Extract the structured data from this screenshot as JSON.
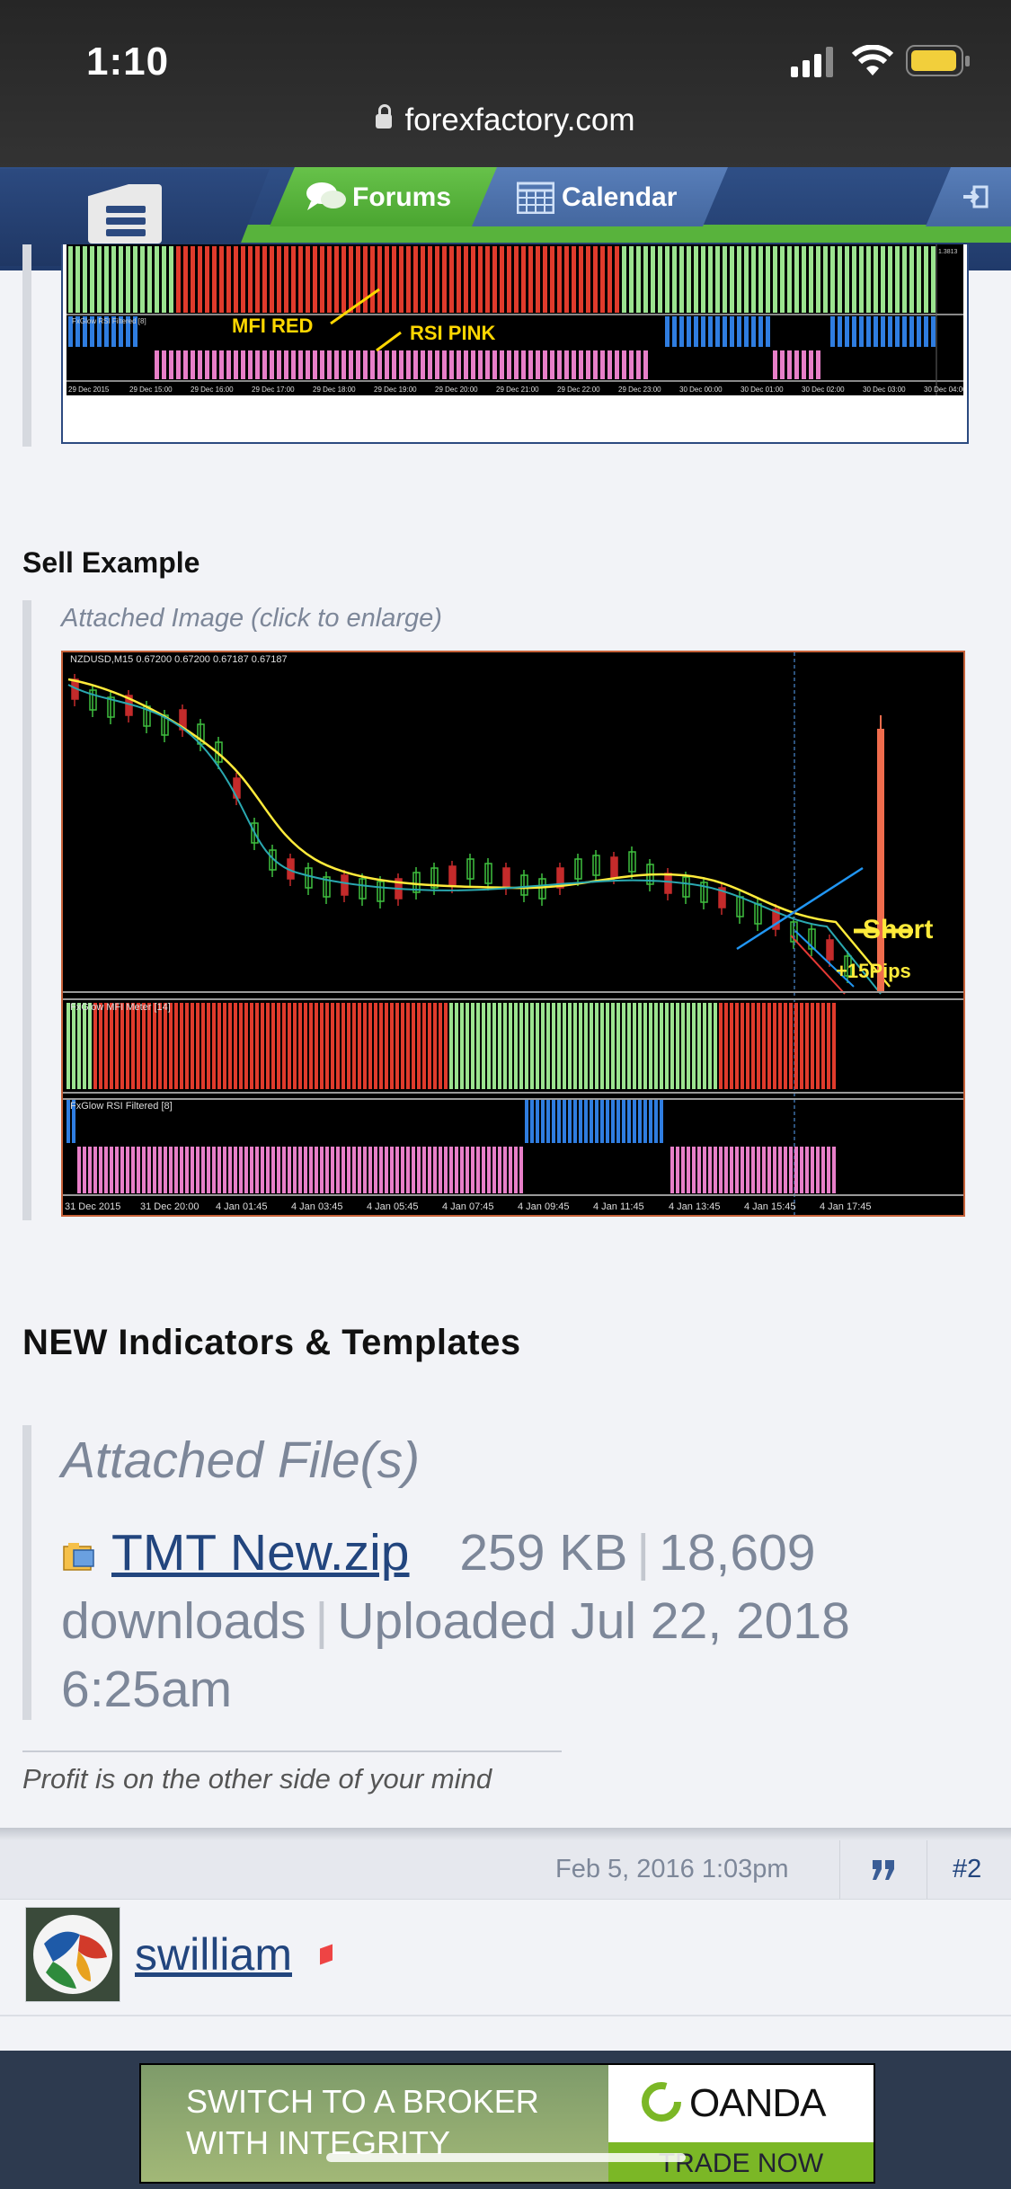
{
  "status_bar": {
    "time": "1:10",
    "url": "forexfactory.com"
  },
  "nav": {
    "forums_label": "Forums",
    "calendar_label": "Calendar"
  },
  "chart_top": {
    "labels": [
      "MFI RED",
      "RSI PINK"
    ],
    "indicator_name": "FxGlow RSI Filtered [8]",
    "time_ticks": [
      "29 Dec 2015",
      "29 Dec 15:00",
      "29 Dec 16:00",
      "29 Dec 17:00",
      "29 Dec 18:00",
      "29 Dec 19:00",
      "29 Dec 20:00",
      "29 Dec 21:00",
      "29 Dec 22:00",
      "29 Dec 23:00",
      "30 Dec 00:00",
      "30 Dec 01:00",
      "30 Dec 02:00",
      "30 Dec 03:00",
      "30 Dec 04:00"
    ]
  },
  "sell_example": {
    "heading": "Sell Example",
    "caption": "Attached Image (click to enlarge)",
    "chart_header": "NZDUSD,M15  0.67200 0.67200 0.67187 0.67187",
    "labels": {
      "short": "Short",
      "pips": "+15Pips"
    },
    "mfi_name": "FxGlow MFI Meter [14]",
    "rsi_name": "FxGlow RSI Filtered [8]",
    "time_ticks": [
      "31 Dec 2015",
      "31 Dec 20:00",
      "4 Jan 01:45",
      "4 Jan 03:45",
      "4 Jan 05:45",
      "4 Jan 07:45",
      "4 Jan 09:45",
      "4 Jan 11:45",
      "4 Jan 13:45",
      "4 Jan 15:45",
      "4 Jan 17:45"
    ]
  },
  "indicators": {
    "heading": "NEW Indicators & Templates",
    "attached_title": "Attached File(s)",
    "file_name": "TMT New.zip",
    "file_size": "259 KB",
    "downloads": "18,609 downloads",
    "uploaded": "Uploaded Jul 22, 2018 6:25am"
  },
  "signature": "Profit is on the other side of your mind",
  "post2": {
    "date": "Feb 5, 2016 1:03pm",
    "number": "#2",
    "username": "swilliam"
  },
  "ad": {
    "line1": "SWITCH TO A BROKER",
    "line2": "WITH INTEGRITY",
    "brand": "OANDA",
    "cta": "TRADE NOW"
  }
}
